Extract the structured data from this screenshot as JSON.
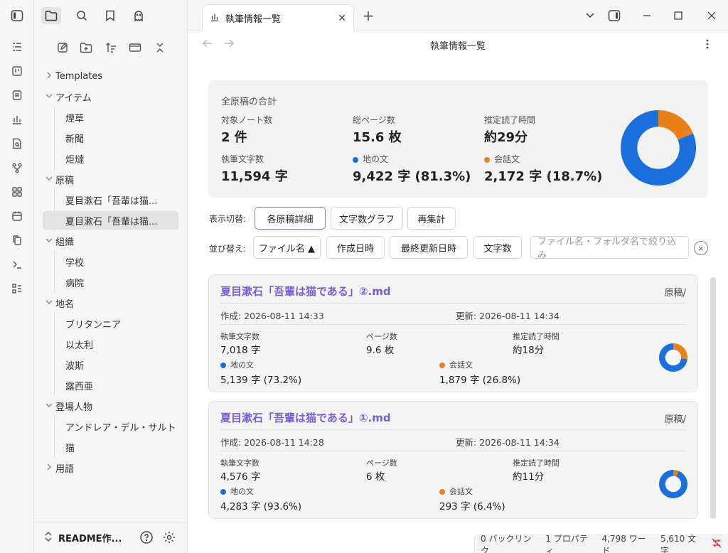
{
  "tab": {
    "title": "執筆情報一覧",
    "new_tab": "+"
  },
  "view": {
    "title": "執筆情報一覧"
  },
  "sidebar": {
    "tree": [
      {
        "label": "Templates",
        "type": "folder",
        "expanded": false
      },
      {
        "label": "アイテム",
        "type": "folder",
        "expanded": true
      },
      {
        "label": "煙草",
        "type": "file"
      },
      {
        "label": "新聞",
        "type": "file"
      },
      {
        "label": "炬燵",
        "type": "file"
      },
      {
        "label": "原稿",
        "type": "folder",
        "expanded": true
      },
      {
        "label": "夏目漱石「吾輩は猫...",
        "type": "file"
      },
      {
        "label": "夏目漱石「吾輩は猫...",
        "type": "file",
        "selected": true
      },
      {
        "label": "組織",
        "type": "folder",
        "expanded": true
      },
      {
        "label": "学校",
        "type": "file"
      },
      {
        "label": "病院",
        "type": "file"
      },
      {
        "label": "地名",
        "type": "folder",
        "expanded": true
      },
      {
        "label": "ブリタンニア",
        "type": "file"
      },
      {
        "label": "以太利",
        "type": "file"
      },
      {
        "label": "波斯",
        "type": "file"
      },
      {
        "label": "露西亜",
        "type": "file"
      },
      {
        "label": "登場人物",
        "type": "folder",
        "expanded": true
      },
      {
        "label": "アンドレア・デル・サルト",
        "type": "file"
      },
      {
        "label": "猫",
        "type": "file"
      },
      {
        "label": "用語",
        "type": "folder",
        "expanded": false
      }
    ],
    "vault_name": "README作..."
  },
  "summary": {
    "heading": "全原稿の合計",
    "notes_label": "対象ノート数",
    "notes_value": "2 件",
    "pages_label": "総ページ数",
    "pages_value": "15.6 枚",
    "time_label": "推定読了時間",
    "time_value": "約29分",
    "chars_label": "執筆文字数",
    "chars_value": "11,594 字",
    "narr_label": "地の文",
    "narr_value": "9,422 字 (81.3%)",
    "dial_label": "会話文",
    "dial_value": "2,172 字 (18.7%)",
    "narr_ratio": 0.813
  },
  "controls": {
    "display_label": "表示切替:",
    "display_buttons": [
      "各原稿詳細",
      "文字数グラフ",
      "再集計"
    ],
    "sort_label": "並び替え:",
    "sort_buttons": [
      "ファイル名 ▲",
      "作成日時",
      "最終更新日時",
      "文字数"
    ],
    "filter_placeholder": "ファイル名・フォルダ名で絞り込み",
    "clear": "×"
  },
  "cards": [
    {
      "title": "夏目漱石「吾輩は猫である」②.md",
      "folder": "原稿/",
      "created": "作成: 2026-08-11 14:33",
      "updated": "更新: 2026-08-11 14:34",
      "chars_label": "執筆文字数",
      "chars_value": "7,018 字",
      "pages_label": "ページ数",
      "pages_value": "9.6 枚",
      "time_label": "推定読了時間",
      "time_value": "約18分",
      "narr_label": "地の文",
      "narr_value": "5,139 字 (73.2%)",
      "dial_label": "会話文",
      "dial_value": "1,879 字 (26.8%)",
      "narr_ratio": 0.732
    },
    {
      "title": "夏目漱石「吾輩は猫である」①.md",
      "folder": "原稿/",
      "created": "作成: 2026-08-11 14:28",
      "updated": "更新: 2026-08-11 14:34",
      "chars_label": "執筆文字数",
      "chars_value": "4,576 字",
      "pages_label": "ページ数",
      "pages_value": "6 枚",
      "time_label": "推定読了時間",
      "time_value": "約11分",
      "narr_label": "地の文",
      "narr_value": "4,283 字 (93.6%)",
      "dial_label": "会話文",
      "dial_value": "293 字 (6.4%)",
      "narr_ratio": 0.936
    }
  ],
  "statusbar": {
    "backlinks": "0 バックリンク",
    "properties": "1 プロパティ",
    "words": "4,798 ワード",
    "chars": "5,610 文字"
  },
  "colors": {
    "narr": "#1a6fdc",
    "dial": "#e8811a",
    "accent": "#7a5cd6"
  }
}
